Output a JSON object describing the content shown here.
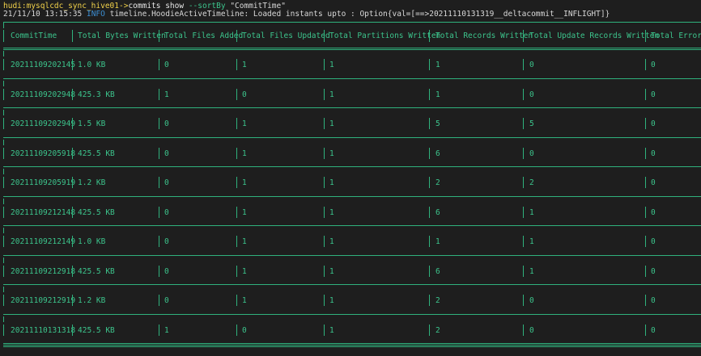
{
  "terminal": {
    "prompt": "hudi:mysqlcdc_sync_hive01->",
    "command": "commits show",
    "flag": "--sortBy",
    "argument": "\"CommitTime\"",
    "log_timestamp": "21/11/10 13:15:35",
    "log_level": "INFO",
    "log_message": "timeline.HoodieActiveTimeline: Loaded instants upto : Option{val=[==>20211110131319__deltacommit__INFLIGHT]}"
  },
  "table": {
    "headers": [
      "CommitTime",
      "Total Bytes Written",
      "Total Files Added",
      "Total Files Updated",
      "Total Partitions Written",
      "Total Records Written",
      "Total Update Records Written",
      "Total Errors"
    ],
    "rows": [
      [
        "20211109202145",
        "1.0 KB",
        "0",
        "1",
        "1",
        "1",
        "0",
        "0"
      ],
      [
        "20211109202948",
        "425.3 KB",
        "1",
        "0",
        "1",
        "1",
        "0",
        "0"
      ],
      [
        "20211109202949",
        "1.5 KB",
        "0",
        "1",
        "1",
        "5",
        "5",
        "0"
      ],
      [
        "20211109205918",
        "425.5 KB",
        "0",
        "1",
        "1",
        "6",
        "0",
        "0"
      ],
      [
        "20211109205919",
        "1.2 KB",
        "0",
        "1",
        "1",
        "2",
        "2",
        "0"
      ],
      [
        "20211109212148",
        "425.5 KB",
        "0",
        "1",
        "1",
        "6",
        "1",
        "0"
      ],
      [
        "20211109212149",
        "1.0 KB",
        "0",
        "1",
        "1",
        "1",
        "1",
        "0"
      ],
      [
        "20211109212918",
        "425.5 KB",
        "0",
        "1",
        "1",
        "6",
        "1",
        "0"
      ],
      [
        "20211109212919",
        "1.2 KB",
        "0",
        "1",
        "1",
        "2",
        "0",
        "0"
      ],
      [
        "20211110131318",
        "425.5 KB",
        "1",
        "0",
        "1",
        "2",
        "0",
        "0"
      ]
    ]
  },
  "colors": {
    "background": "#1e1e1e",
    "table_text": "#3cc48c",
    "border": "#2fb27d",
    "prompt": "#f2d24a",
    "info": "#3c8fd4"
  }
}
